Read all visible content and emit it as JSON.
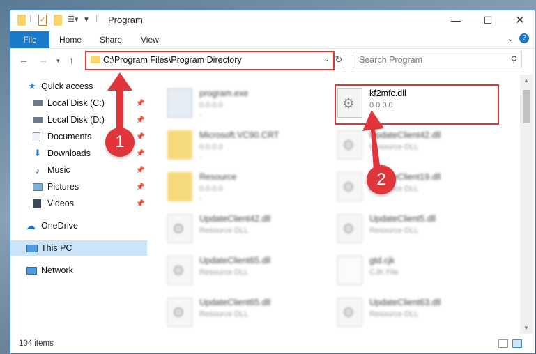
{
  "window": {
    "title": "Program"
  },
  "ribbon": {
    "file_tab": "File",
    "tabs": [
      "Home",
      "Share",
      "View"
    ]
  },
  "address": {
    "path": "C:\\Program Files\\Program Directory"
  },
  "search": {
    "placeholder": "Search Program"
  },
  "sidebar": {
    "quick_access": "Quick access",
    "items": [
      {
        "label": "Local Disk (C:)",
        "icon": "drive-icon",
        "pinned": true
      },
      {
        "label": "Local Disk (D:)",
        "icon": "drive-icon",
        "pinned": true
      },
      {
        "label": "Documents",
        "icon": "documents-icon",
        "pinned": true
      },
      {
        "label": "Downloads",
        "icon": "downloads-icon",
        "pinned": true
      },
      {
        "label": "Music",
        "icon": "music-icon",
        "pinned": true
      },
      {
        "label": "Pictures",
        "icon": "pictures-icon",
        "pinned": true
      },
      {
        "label": "Videos",
        "icon": "videos-icon",
        "pinned": true
      }
    ],
    "onedrive": "OneDrive",
    "this_pc": "This PC",
    "network": "Network"
  },
  "files": [
    {
      "name": "program.exe",
      "sub": "0.0.0.0",
      "sub2": "-",
      "icon": "exe-icon"
    },
    {
      "name": "kf2mfc.dll",
      "sub": "0.0.0.0",
      "sub2": "-",
      "icon": "dll-icon"
    },
    {
      "name": "Microsoft.VC90.CRT",
      "sub": "0.0.0.0",
      "sub2": "-",
      "icon": "folder-icon"
    },
    {
      "name": "UpdateClient42.dll",
      "sub": "Resource DLL",
      "sub2": "",
      "icon": "dll-icon"
    },
    {
      "name": "Resource",
      "sub": "0.0.0.0",
      "sub2": "-",
      "icon": "folder-icon"
    },
    {
      "name": "UpdateClient19.dll",
      "sub": "Resource DLL",
      "sub2": "",
      "icon": "dll-icon"
    },
    {
      "name": "UpdateClient42.dll",
      "sub": "Resource DLL",
      "sub2": "",
      "icon": "dll-icon"
    },
    {
      "name": "UpdateClient5.dll",
      "sub": "Resource DLL",
      "sub2": "",
      "icon": "dll-icon"
    },
    {
      "name": "UpdateClient65.dll",
      "sub": "Resource DLL",
      "sub2": "",
      "icon": "dll-icon"
    },
    {
      "name": "gtd.cjk",
      "sub": "CJK File",
      "sub2": "",
      "icon": "doc-icon"
    },
    {
      "name": "UpdateClient65.dll",
      "sub": "Resource DLL",
      "sub2": "",
      "icon": "dll-icon"
    },
    {
      "name": "UpdateClient63.dll",
      "sub": "Resource DLL",
      "sub2": "",
      "icon": "dll-icon"
    }
  ],
  "status": {
    "count": "104 items"
  },
  "annotations": {
    "step1": "1",
    "step2": "2",
    "color": "#e0353a"
  }
}
